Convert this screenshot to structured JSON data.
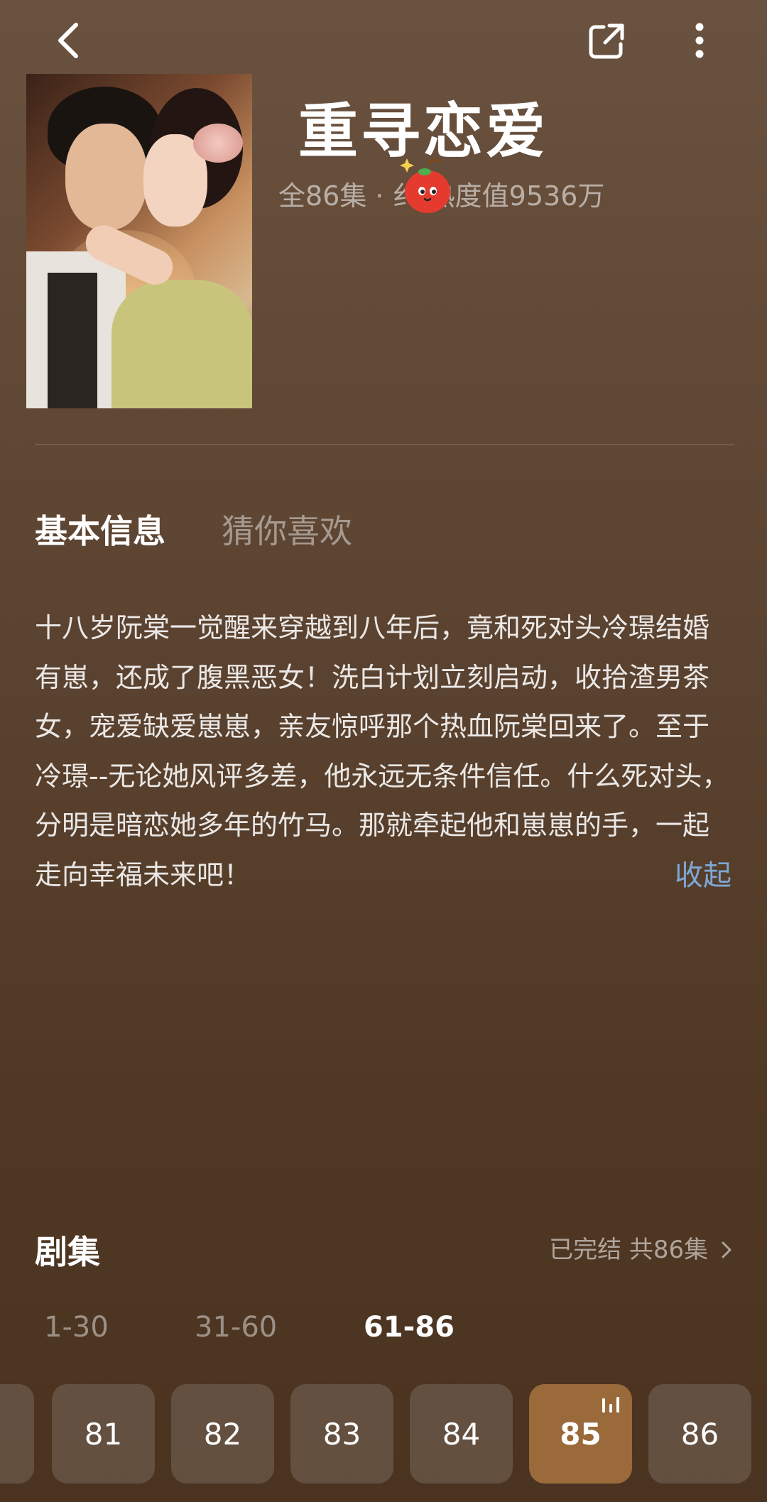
{
  "header": {
    "back_icon": "chevron-left-icon",
    "share_icon": "share-icon",
    "more_icon": "more-vertical-icon"
  },
  "drama": {
    "title": "重寻恋爱",
    "meta": "全86集 · 纟   热度值9536万"
  },
  "tabs": [
    {
      "label": "基本信息",
      "active": true
    },
    {
      "label": "猜你喜欢",
      "active": false
    }
  ],
  "synopsis": {
    "text": "十八岁阮棠一觉醒来穿越到八年后，竟和死对头冷璟结婚有崽，还成了腹黑恶女！洗白计划立刻启动，收拾渣男茶女，宠爱缺爱崽崽，亲友惊呼那个热血阮棠回来了。至于冷璟--无论她风评多差，他永远无条件信任。什么死对头，分明是暗恋她多年的竹马。那就牵起他和崽崽的手，一起走向幸福未来吧！",
    "collapse_label": "收起"
  },
  "episodes": {
    "heading": "剧集",
    "status": "已完结 共86集",
    "ranges": [
      {
        "label": "1-30",
        "active": false
      },
      {
        "label": "31-60",
        "active": false
      },
      {
        "label": "61-86",
        "active": true
      }
    ],
    "items": [
      {
        "label": "81",
        "active": false
      },
      {
        "label": "82",
        "active": false
      },
      {
        "label": "83",
        "active": false
      },
      {
        "label": "84",
        "active": false
      },
      {
        "label": "85",
        "active": true
      },
      {
        "label": "86",
        "active": false
      }
    ]
  },
  "colors": {
    "accent_link": "#7fa7d6",
    "active_episode": "#9a6a3a"
  }
}
